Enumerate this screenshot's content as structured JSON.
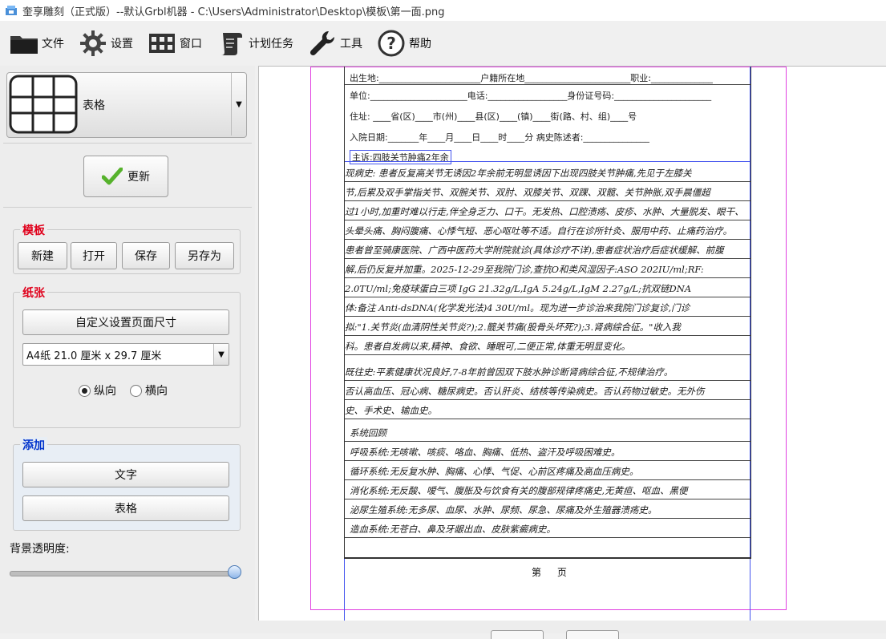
{
  "window": {
    "title": "奎享雕刻（正式版）--默认Grbl机器 - C:\\Users\\Administrator\\Desktop\\模板\\第一面.png"
  },
  "toolbar": {
    "items": [
      {
        "label": "文件",
        "icon": "folder-icon"
      },
      {
        "label": "设置",
        "icon": "gear-icon"
      },
      {
        "label": "窗口",
        "icon": "window-icon"
      },
      {
        "label": "计划任务",
        "icon": "scroll-icon"
      },
      {
        "label": "工具",
        "icon": "wrench-icon"
      },
      {
        "label": "帮助",
        "icon": "help-icon"
      }
    ]
  },
  "left": {
    "tool_select": "表格",
    "update_label": "更新",
    "template_group": {
      "title": "模板",
      "buttons": [
        "新建",
        "打开",
        "保存",
        "另存为"
      ]
    },
    "paper_group": {
      "title": "纸张",
      "custom_size_label": "自定义设置页面尺寸",
      "paper_size": "A4纸 21.0 厘米 x 29.7 厘米",
      "portrait_label": "纵向",
      "landscape_label": "横向",
      "orientation": "纵向"
    },
    "add_group": {
      "title": "添加",
      "text_label": "文字",
      "table_label": "表格"
    },
    "opacity_label": "背景透明度:",
    "opacity_value": 1.0
  },
  "colors": {
    "red_legend": "#e0001b",
    "blue_legend": "#0033cc",
    "margin_guide": "#e040e0"
  },
  "document": {
    "form_lines": [
      "出生地:_______________________户籍所在地________________________职业:______________",
      "单位:______________________电话:__________________身份证号码:______________________",
      "住址: ____省(区)____市(州)____县(区)____(镇)____街(路、村、组)____号",
      "入院日期:_______年____月____日____时____分             病史陈述者:_______________"
    ],
    "chief_complaint": "主诉:四肢关节肿痛2年余",
    "hw_lines": [
      "现病史:    患者反复高关节无诱因2年余前无明显诱因下出现四肢关节肿痛,先见于左膝关",
      "节,后累及双手掌指关节、双腕关节、双肘、双膝关节、双踝、双髋、关节肿胀,双手晨僵超",
      "过1小时,加重时难以行走,伴全身乏力、口干。无发热、口腔溃疡、皮疹、水肿、大量脱发、眼干、",
      "头晕头痛、胸闷腹痛、心悸气短、恶心呕吐等不适。自行在诊所针灸、服用中药、止痛药治疗。",
      "患者曾至骑康医院、广西中医药大学附院就诊(具体诊疗不详),患者症状治疗后症状缓解、前腹",
      "解,后仍反复并加重。2025-12-29至我院门诊,查抗O和类风湿因子:ASO 202IU/ml;RF:",
      "2.0TU/ml;免疫球蛋白三项 IgG 21.32g/L,IgA 5.24g/L,IgM 2.27g/L;抗双链DNA",
      "体:备注 Anti-dsDNA(化学发光法)4 30U/ml。现为进一步诊治来我院门诊复诊,门诊",
      "拟:\"1.关节炎(血清阴性关节炎?);2.髋关节痛(股骨头坏死?);3.肾病综合征。\"收入我",
      "科。患者自发病以来,精神、食欲、睡眠可,二便正常,体重无明显变化。",
      "    既往史:平素健康状况良好,7-8年前曾因双下肢水肿诊断肾病综合征,不规律治疗。",
      "否认高血压、冠心病、糖尿病史。否认肝炎、结核等传染病史。否认药物过敏史。无外伤",
      "史、手术史、输血史。",
      "系统回顾",
      "呼吸系统:无咳嗽、咳痰、咯血、胸痛、低热、盗汗及呼吸困难史。",
      "循环系统:无反复水肿、胸痛、心悸、气促、心前区疼痛及高血压病史。",
      "消化系统:无反酸、嗳气、腹胀及与饮食有关的腹部规律疼痛史,无黄疸、呕血、黑便",
      "泌尿生殖系统:无多尿、血尿、水肿、尿频、尿急、尿痛及外生殖器溃疡史。",
      "造血系统:无苍白、鼻及牙龈出血、皮肤紫癜病史。"
    ],
    "page_label": "第 页"
  }
}
